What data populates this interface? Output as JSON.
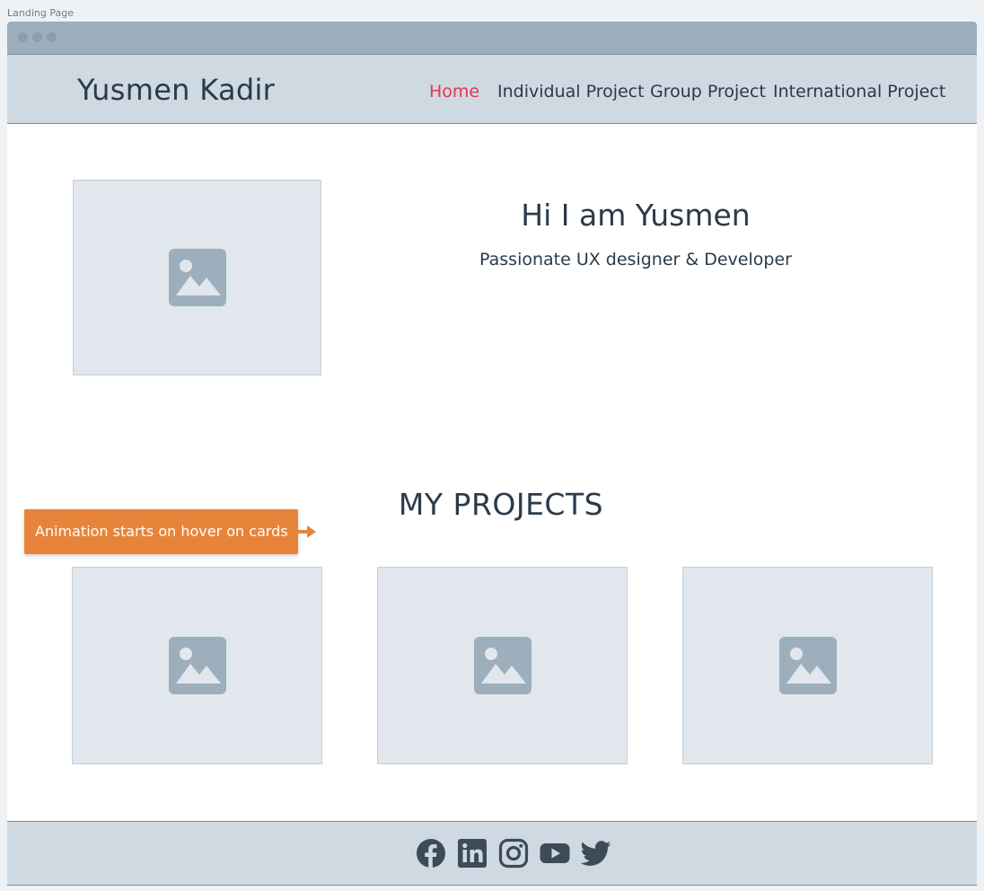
{
  "frame": {
    "label": "Landing Page"
  },
  "header": {
    "brand": "Yusmen Kadir",
    "nav": [
      {
        "label": "Home",
        "active": true
      },
      {
        "label": "Individual Project",
        "active": false
      },
      {
        "label": "Group Project",
        "active": false
      },
      {
        "label": "International Project",
        "active": false
      }
    ]
  },
  "hero": {
    "title": "Hi I am Yusmen",
    "subtitle": "Passionate UX designer & Developer",
    "image_icon": "image-placeholder-icon"
  },
  "projects": {
    "title": "MY PROJECTS",
    "annotation": "Animation starts on hover on cards",
    "cards": [
      {
        "icon": "image-placeholder-icon"
      },
      {
        "icon": "image-placeholder-icon"
      },
      {
        "icon": "image-placeholder-icon"
      }
    ]
  },
  "footer": {
    "social": [
      "facebook-icon",
      "linkedin-icon",
      "instagram-icon",
      "youtube-icon",
      "twitter-icon"
    ]
  },
  "colors": {
    "accent": "#e0394c",
    "annotation": "#e8843a",
    "navbar": "#cfd9e2",
    "text": "#2b3a4a",
    "placeholder": "#e1e7ec",
    "icon": "#9daebc"
  }
}
